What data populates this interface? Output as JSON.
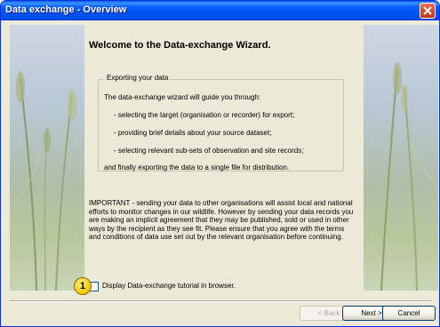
{
  "window": {
    "title": "Data exchange - Overview"
  },
  "heading": "Welcome to the Data-exchange Wizard.",
  "export_group": {
    "legend": "Exporting your data",
    "intro": "The data-exchange wizard will guide you through:",
    "steps": [
      "- selecting the target (organisation or recorder) for export;",
      "- providing brief details about your source dataset;",
      "- selecting relevant sub-sets of observation and site records;"
    ],
    "outro": "and finally exporting the data to a single file for distribution."
  },
  "important_text": "IMPORTANT - sending your data to other organisations will assist local and national efforts to monitor changes in our wildlife.  However by sending your data records you are making an implicit agreement that they may be published, sold or used in other ways by the recipient as they see fit. Please ensure that you agree with the terms and conditions of data use set out by the relevant organisation before continuing.",
  "tutorial_checkbox": {
    "label": "Display Data-exchange tutorial in browser.",
    "checked": false
  },
  "callout": "1",
  "buttons": {
    "back": "< Back",
    "next": "Next >",
    "cancel": "Cancel"
  },
  "colors": {
    "titlebar": "#0054e3",
    "dialog_bg": "#ece9d8",
    "callout": "#f2c40c"
  }
}
